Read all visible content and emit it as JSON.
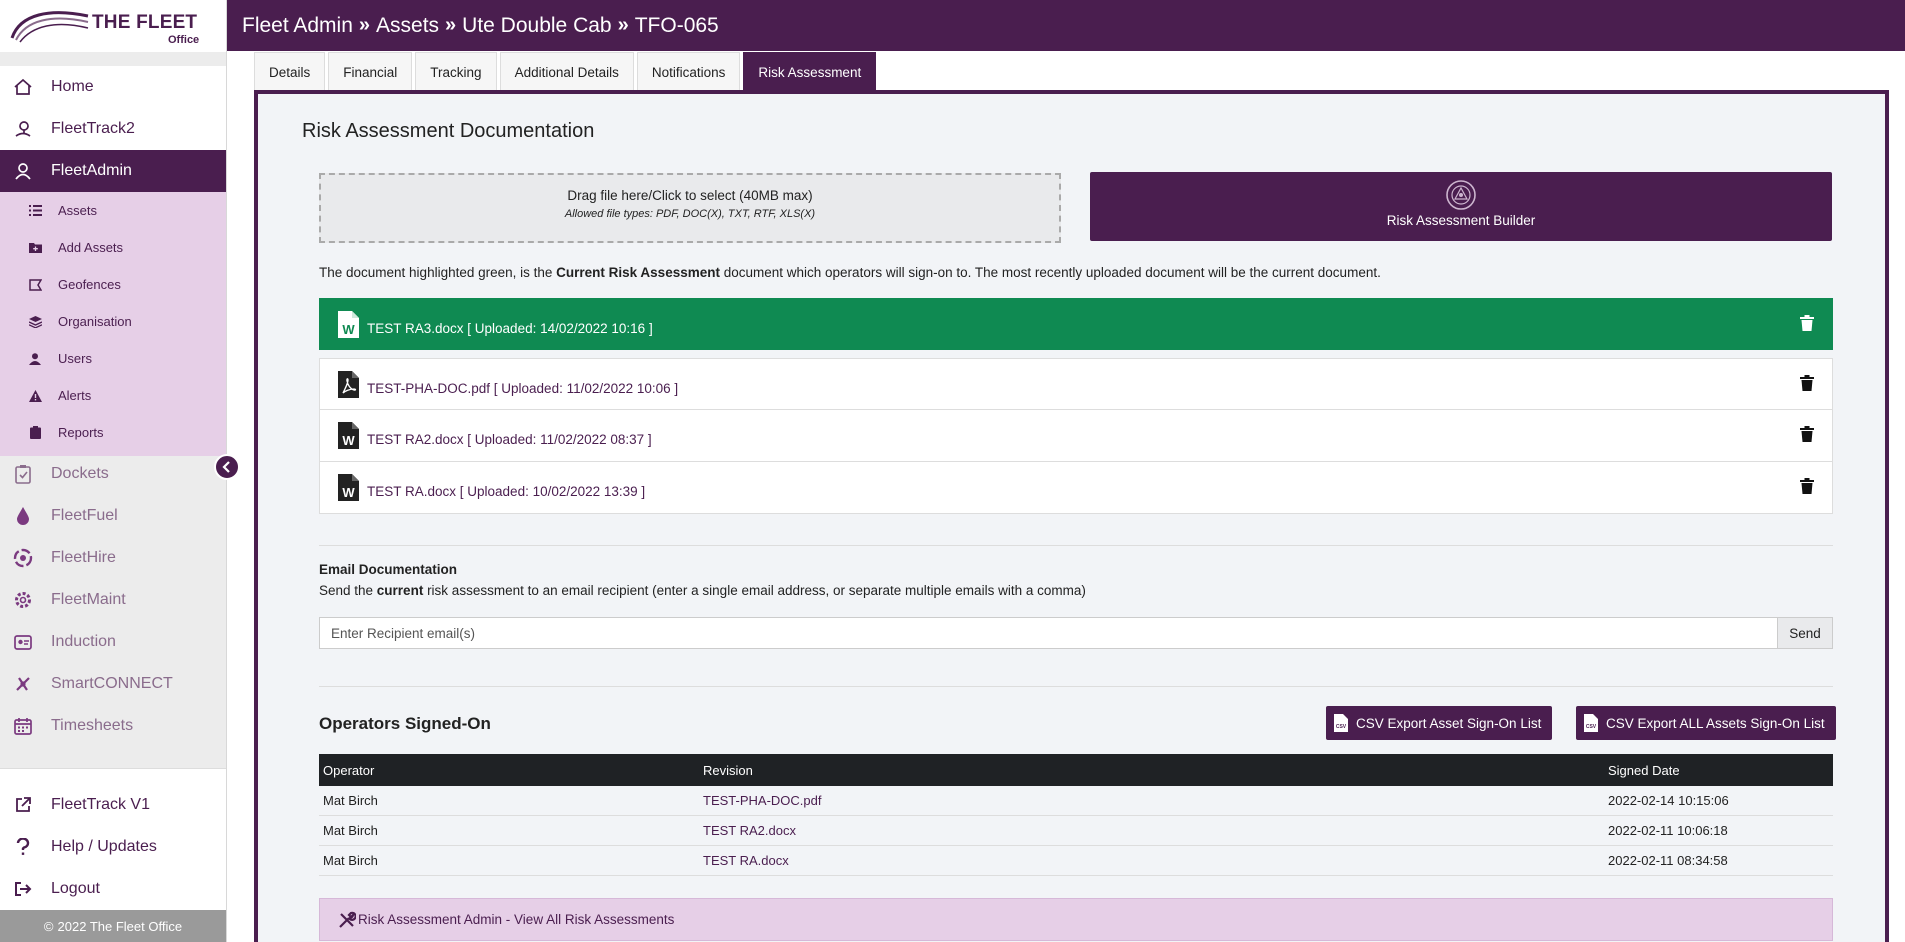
{
  "logo": {
    "brand": "THE FLEET",
    "sub": "Office"
  },
  "nav": {
    "top": [
      {
        "label": "Home",
        "icon": "home-icon"
      },
      {
        "label": "FleetTrack2",
        "icon": "map-pin-icon"
      }
    ],
    "active": {
      "label": "FleetAdmin",
      "icon": "user-icon"
    },
    "submenu": [
      {
        "label": "Assets",
        "icon": "list-icon"
      },
      {
        "label": "Add Assets",
        "icon": "folder-plus-icon"
      },
      {
        "label": "Geofences",
        "icon": "map-icon"
      },
      {
        "label": "Organisation",
        "icon": "layers-icon"
      },
      {
        "label": "Users",
        "icon": "user-icon"
      },
      {
        "label": "Alerts",
        "icon": "warning-icon"
      },
      {
        "label": "Reports",
        "icon": "clipboard-icon"
      }
    ],
    "modules": [
      {
        "label": "Dockets",
        "icon": "clipboard-check-icon"
      },
      {
        "label": "FleetFuel",
        "icon": "droplet-icon"
      },
      {
        "label": "FleetHire",
        "icon": "hire-icon"
      },
      {
        "label": "FleetMaint",
        "icon": "gear-icon"
      },
      {
        "label": "Induction",
        "icon": "badge-icon"
      },
      {
        "label": "SmartCONNECT",
        "icon": "connect-icon"
      },
      {
        "label": "Timesheets",
        "icon": "calendar-icon"
      }
    ],
    "bottom": [
      {
        "label": "FleetTrack V1",
        "icon": "external-link-icon"
      },
      {
        "label": "Help / Updates",
        "icon": "question-icon"
      },
      {
        "label": "Logout",
        "icon": "logout-icon"
      }
    ],
    "copyright": "2022 The Fleet Office"
  },
  "header": {
    "crumbs": [
      "Fleet Admin",
      "Assets",
      "Ute Double Cab",
      "TFO-065"
    ]
  },
  "tabs": [
    "Details",
    "Financial",
    "Tracking",
    "Additional Details",
    "Notifications",
    "Risk Assessment"
  ],
  "active_tab": "Risk Assessment",
  "panel": {
    "title": "Risk Assessment Documentation",
    "dropzone": {
      "line1": "Drag file here/Click to select (40MB max)",
      "line2": "Allowed file types: PDF, DOC(X), TXT, RTF, XLS(X)"
    },
    "builder_label": "Risk Assessment Builder",
    "note": {
      "pre": "The document highlighted green, is the ",
      "bold": "Current Risk Assessment",
      "post": " document which operators will sign-on to. The most recently uploaded document will be the current document."
    },
    "documents": [
      {
        "name": "TEST RA3.docx [ Uploaded: 14/02/2022 10:16 ]",
        "type": "word",
        "current": true
      },
      {
        "name": "TEST-PHA-DOC.pdf [ Uploaded: 11/02/2022 10:06 ]",
        "type": "pdf",
        "current": false
      },
      {
        "name": "TEST RA2.docx [ Uploaded: 11/02/2022 08:37 ]",
        "type": "word",
        "current": false
      },
      {
        "name": "TEST RA.docx [ Uploaded: 10/02/2022 13:39 ]",
        "type": "word",
        "current": false
      }
    ],
    "email": {
      "title": "Email Documentation",
      "desc_pre": "Send the ",
      "desc_bold": "current",
      "desc_post": " risk assessment to an email recipient (enter a single email address, or separate multiple emails with a comma)",
      "placeholder": "Enter Recipient email(s)",
      "send_label": "Send"
    },
    "operators": {
      "title": "Operators Signed-On",
      "csv_asset": "CSV Export Asset Sign-On List",
      "csv_all": "CSV Export ALL Assets Sign-On List",
      "columns": [
        "Operator",
        "Revision",
        "Signed Date"
      ],
      "rows": [
        {
          "operator": "Mat Birch",
          "revision": "TEST-PHA-DOC.pdf",
          "date": "2022-02-14 10:15:06"
        },
        {
          "operator": "Mat Birch",
          "revision": "TEST RA2.docx",
          "date": "2022-02-11 10:06:18"
        },
        {
          "operator": "Mat Birch",
          "revision": "TEST RA.docx",
          "date": "2022-02-11 08:34:58"
        }
      ]
    },
    "admin_link": "Risk Assessment Admin - View All Risk Assessments"
  },
  "colors": {
    "brand": "#4a1e4f",
    "current_doc": "#0f8a52",
    "submenu_bg": "#e6cfe7"
  }
}
